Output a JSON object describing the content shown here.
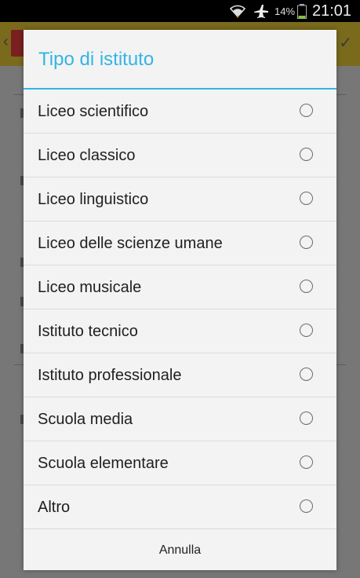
{
  "status_bar": {
    "battery_percent": "14%",
    "time": "21:01",
    "icons": [
      "wifi-icon",
      "airplane-mode-icon",
      "battery-icon"
    ]
  },
  "dialog": {
    "title": "Tipo di istituto",
    "options": [
      {
        "label": "Liceo scientifico",
        "selected": false
      },
      {
        "label": "Liceo classico",
        "selected": false
      },
      {
        "label": "Liceo linguistico",
        "selected": false
      },
      {
        "label": "Liceo delle scienze umane",
        "selected": false
      },
      {
        "label": "Liceo musicale",
        "selected": false
      },
      {
        "label": "Istituto tecnico",
        "selected": false
      },
      {
        "label": "Istituto professionale",
        "selected": false
      },
      {
        "label": "Scuola media",
        "selected": false
      },
      {
        "label": "Scuola elementare",
        "selected": false
      },
      {
        "label": "Altro",
        "selected": false
      }
    ],
    "cancel_label": "Annulla"
  },
  "colors": {
    "accent": "#33b5e5",
    "dialog_background": "#f3f3f3",
    "status_bar": "#000000"
  }
}
